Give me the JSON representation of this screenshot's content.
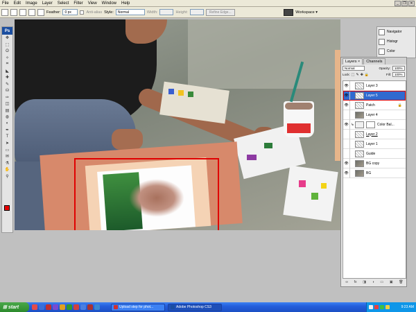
{
  "menubar": {
    "items": [
      "File",
      "Edit",
      "Image",
      "Layer",
      "Select",
      "Filter",
      "View",
      "Window",
      "Help"
    ]
  },
  "options_bar": {
    "feather_label": "Feather:",
    "feather_value": "0 px",
    "antialias_label": "Anti-alias",
    "style_label": "Style:",
    "style_value": "Normal",
    "width_label": "Width:",
    "height_label": "Height:",
    "refine_edge_label": "Refine Edge...",
    "workspace_label": "Workspace ▾"
  },
  "tools": {
    "logo": "Ps",
    "icons": [
      "move-icon",
      "marquee-icon",
      "lasso-icon",
      "magic-wand-icon",
      "crop-icon",
      "slice-icon",
      "healing-icon",
      "brush-icon",
      "stamp-icon",
      "history-brush-icon",
      "eraser-icon",
      "gradient-icon",
      "blur-icon",
      "dodge-icon",
      "pen-icon",
      "type-icon",
      "path-select-icon",
      "shape-icon",
      "notes-icon",
      "eyedropper-icon",
      "hand-icon",
      "zoom-icon"
    ],
    "glyphs": [
      "✥",
      "⬚",
      "ʘ",
      "✧",
      "⌗",
      "◣",
      "✚",
      "✎",
      "⛁",
      "✑",
      "◫",
      "▤",
      "◍",
      "◐",
      "✒",
      "T",
      "➤",
      "▭",
      "✉",
      "⚗",
      "✋",
      "⚲"
    ],
    "foreground_color": "#e80000",
    "background_color": "#ffffff"
  },
  "right_panels": {
    "navigator_label": "Navigator",
    "histogram_label": "Histogr",
    "color_label": "Color"
  },
  "layers_panel": {
    "tabs": [
      "Layers ×",
      "Channels"
    ],
    "blend_mode": "Normal",
    "opacity_label": "Opacity:",
    "opacity_value": "100%",
    "lock_label": "Lock:",
    "fill_label": "Fill:",
    "fill_value": "100%",
    "layers": [
      {
        "name": "Layer 3",
        "thumb": "transparent",
        "visible": true,
        "selected": false,
        "highlight": false
      },
      {
        "name": "Layer 5",
        "thumb": "transparent",
        "visible": true,
        "selected": true,
        "highlight": true
      },
      {
        "name": "Patch",
        "thumb": "transparent",
        "visible": true,
        "selected": false,
        "highlight": false,
        "locked": true
      },
      {
        "name": "Layer 4",
        "thumb": "photo",
        "visible": false,
        "selected": false,
        "highlight": false
      },
      {
        "name": "Color Bal...",
        "thumb": "mask",
        "visible": true,
        "selected": false,
        "highlight": false,
        "adjust": true
      },
      {
        "name": "Layer 2",
        "thumb": "transparent",
        "visible": false,
        "selected": false,
        "highlight": false,
        "underline": true
      },
      {
        "name": "Layer 1",
        "thumb": "transparent",
        "visible": false,
        "selected": false,
        "highlight": false
      },
      {
        "name": "Guide",
        "thumb": "transparent",
        "visible": false,
        "selected": false,
        "highlight": false
      },
      {
        "name": "BG copy",
        "thumb": "photo",
        "visible": true,
        "selected": false,
        "highlight": false
      },
      {
        "name": "BG",
        "thumb": "photo",
        "visible": true,
        "selected": false,
        "highlight": false
      }
    ],
    "footer_icons": [
      "link-icon",
      "fx-icon",
      "mask-icon",
      "adjustment-icon",
      "folder-icon",
      "new-layer-icon",
      "trash-icon"
    ],
    "footer_glyphs": [
      "∞",
      "fx",
      "◨",
      "◑",
      "▭",
      "▣",
      "🗑"
    ]
  },
  "taskbar": {
    "start_label": "start",
    "tasks": [
      {
        "label": "Upload step for phot...",
        "active": false,
        "icon_color": "#d03030"
      },
      {
        "label": "Adobe Photoshop CS3",
        "active": true,
        "icon_color": "#1b4ea0"
      }
    ],
    "clock": "9:23 AM"
  }
}
